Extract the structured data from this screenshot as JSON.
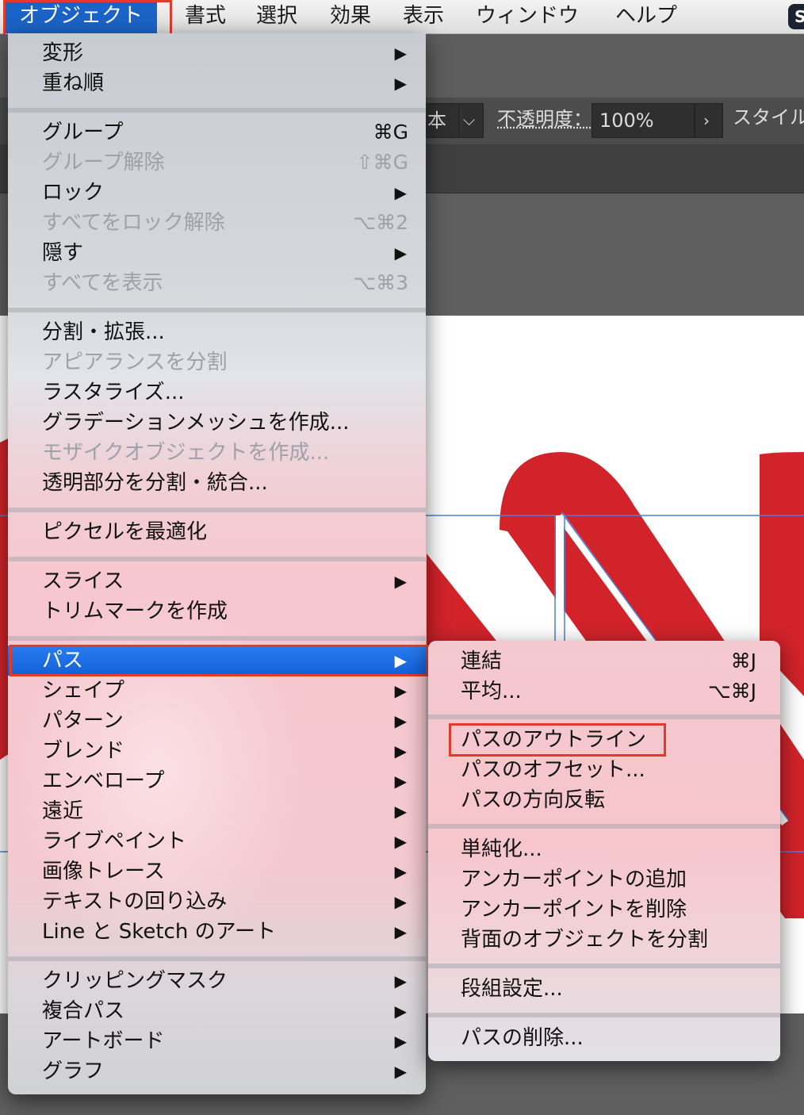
{
  "menubar": {
    "active": "オブジェクト",
    "items": [
      "書式",
      "選択",
      "効果",
      "表示",
      "ウィンドウ",
      "ヘルプ"
    ],
    "app_badge": "S"
  },
  "controlbar": {
    "style_value_fragment": "本",
    "opacity_label": "不透明度：",
    "opacity_value": "100%",
    "style_label": "スタイル"
  },
  "object_menu": {
    "transform": "変形",
    "arrange": "重ね順",
    "group": "グループ",
    "group_sc": "⌘G",
    "ungroup": "グループ解除",
    "ungroup_sc": "⇧⌘G",
    "lock": "ロック",
    "unlock_all": "すべてをロック解除",
    "unlock_all_sc": "⌥⌘2",
    "hide": "隠す",
    "show_all": "すべてを表示",
    "show_all_sc": "⌥⌘3",
    "expand": "分割・拡張...",
    "expand_appearance": "アピアランスを分割",
    "rasterize": "ラスタライズ...",
    "gradient_mesh": "グラデーションメッシュを作成...",
    "mosaic": "モザイクオブジェクトを作成...",
    "flatten": "透明部分を分割・統合...",
    "pixel_optimize": "ピクセルを最適化",
    "slice": "スライス",
    "trim_marks": "トリムマークを作成",
    "path": "パス",
    "shape": "シェイプ",
    "pattern": "パターン",
    "blend": "ブレンド",
    "envelope": "エンベロープ",
    "perspective": "遠近",
    "live_paint": "ライブペイント",
    "image_trace": "画像トレース",
    "text_wrap": "テキストの回り込み",
    "line_sketch": "Line と Sketch のアート",
    "clipping_mask": "クリッピングマスク",
    "compound_path": "複合パス",
    "artboard": "アートボード",
    "graph": "グラフ"
  },
  "path_submenu": {
    "join": "連結",
    "join_sc": "⌘J",
    "average": "平均...",
    "average_sc": "⌥⌘J",
    "outline_stroke": "パスのアウトライン",
    "offset_path": "パスのオフセット...",
    "reverse_direction": "パスの方向反転",
    "simplify": "単純化...",
    "add_anchor": "アンカーポイントの追加",
    "remove_anchor": "アンカーポイントを削除",
    "divide_below": "背面のオブジェクトを分割",
    "split_grid": "段組設定...",
    "clean_up": "パスの削除..."
  },
  "submenu_arrow": "▶",
  "colors": {
    "highlight": "#1a64c8",
    "annotation": "#e03c2e",
    "artwork_red": "#d2232a"
  }
}
